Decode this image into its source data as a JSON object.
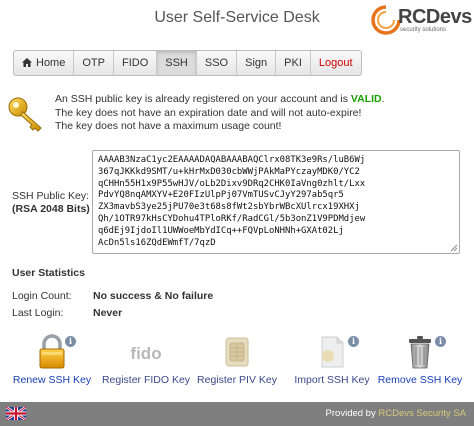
{
  "header": {
    "title": "User Self-Service Desk"
  },
  "logo": {
    "name": "RCDevs",
    "tagline": "security solutions"
  },
  "nav": {
    "tabs": [
      {
        "label": "Home",
        "icon": "home-icon",
        "active": false
      },
      {
        "label": "OTP",
        "active": false
      },
      {
        "label": "FIDO",
        "active": false
      },
      {
        "label": "SSH",
        "active": true
      },
      {
        "label": "SSO",
        "active": false
      },
      {
        "label": "Sign",
        "active": false
      },
      {
        "label": "PKI",
        "active": false
      },
      {
        "label": "Logout",
        "active": false
      }
    ]
  },
  "status": {
    "line1_prefix": "An SSH public key is already registered on your account and is ",
    "line1_valid": "VALID",
    "line1_suffix": ".",
    "line2": "The key does not have an expiration date and will not auto-expire!",
    "line3": "The key does not have a maximum usage count!"
  },
  "public_key": {
    "label": "SSH Public Key:",
    "sublabel": "(RSA 2048 Bits)",
    "lines": [
      "AAAAB3NzaC1yc2EAAAADAQABAAABAQClrx08TK3e9Rs/luB6Wj",
      "367qJKKkd9SMT/u+kHrMxD030cbWWjPAkMaPYczayMDK0/YC2",
      "qCHHn55H1x9P55wHJV/oLb2Dixv9DRq2CHK0IaVng0zhlt/Lxx",
      "PdvYQ8nqAMXYV+E20FIzUlpPj07VmTUSvCJyY297ab5qr5",
      "ZX3mavbS3ye25jPU70e3t68s8fWt2sbYbrWBcXUlrcx19XHXj",
      "Qh/1OTR97kHsCYDohu4TPloRKf/RadCGl/5b3onZ1V9PDMdjew",
      "q6dEj9IjdoIl1UWWoeMbYdICq++FQVpLoNHNh+GXAt02Lj",
      "AcDn5ls16ZQdEWmfT/7qzD"
    ]
  },
  "statistics": {
    "title": "User Statistics",
    "login_count_label": "Login Count:",
    "login_count_value": "No success & No failure",
    "last_login_label": "Last Login:",
    "last_login_value": "Never"
  },
  "actions": [
    {
      "label": "Renew SSH Key",
      "icon": "padlock-icon",
      "enabled": true
    },
    {
      "label": "Register FIDO Key",
      "icon": "fido-icon",
      "enabled": false
    },
    {
      "label": "Register PIV Key",
      "icon": "smartcard-chip-icon",
      "enabled": false
    },
    {
      "label": "Import SSH Key",
      "icon": "import-document-icon",
      "enabled": false
    },
    {
      "label": "Remove SSH Key",
      "icon": "trash-can-icon",
      "enabled": true
    }
  ],
  "footer": {
    "provided_by": "Provided by",
    "brand": "RCDevs Security SA",
    "language_icon": "uk-flag-icon"
  },
  "colors": {
    "valid": "#18a000",
    "logout": "#d00000",
    "link": "#1a3fb8",
    "footer_bg": "#7f7f7f"
  }
}
